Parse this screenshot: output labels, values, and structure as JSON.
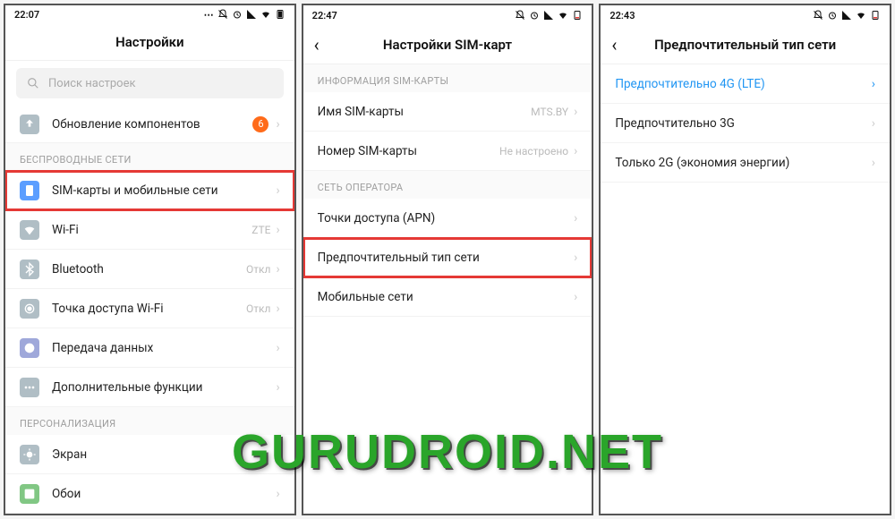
{
  "watermark": "GURUDROID.NET",
  "screen1": {
    "time": "22:07",
    "title": "Настройки",
    "search_placeholder": "Поиск настроек",
    "update_row": {
      "label": "Обновление компонентов",
      "badge": "6"
    },
    "section_wireless": "БЕСПРОВОДНЫЕ СЕТИ",
    "rows_wireless": [
      {
        "label": "SIM-карты и мобильные сети",
        "value": "",
        "highlight": true,
        "icon": "sim"
      },
      {
        "label": "Wi-Fi",
        "value": "ZTE",
        "icon": "wifi"
      },
      {
        "label": "Bluetooth",
        "value": "Откл",
        "icon": "bluetooth"
      },
      {
        "label": "Точка доступа Wi-Fi",
        "value": "Откл",
        "icon": "hotspot"
      },
      {
        "label": "Передача данных",
        "value": "",
        "icon": "data"
      },
      {
        "label": "Дополнительные функции",
        "value": "",
        "icon": "more"
      }
    ],
    "section_personal": "ПЕРСОНАЛИЗАЦИЯ",
    "rows_personal": [
      {
        "label": "Экран",
        "icon": "display"
      },
      {
        "label": "Обои",
        "icon": "wallpaper"
      }
    ]
  },
  "screen2": {
    "time": "22:47",
    "title": "Настройки SIM-карт",
    "section_info": "ИНФОРМАЦИЯ SIM-КАРТЫ",
    "rows_info": [
      {
        "label": "Имя SIM-карты",
        "value": "MTS.BY"
      },
      {
        "label": "Номер SIM-карты",
        "value": "Не настроено"
      }
    ],
    "section_operator": "СЕТЬ ОПЕРАТОРА",
    "rows_operator": [
      {
        "label": "Точки доступа (APN)",
        "highlight": false
      },
      {
        "label": "Предпочтительный тип сети",
        "highlight": true
      },
      {
        "label": "Мобильные сети",
        "highlight": false
      }
    ]
  },
  "screen3": {
    "time": "22:43",
    "title": "Предпочтительный тип сети",
    "options": [
      {
        "label": "Предпочтительно 4G (LTE)",
        "selected": true
      },
      {
        "label": "Предпочтительно 3G",
        "selected": false
      },
      {
        "label": "Только 2G (экономия энергии)",
        "selected": false
      }
    ]
  }
}
